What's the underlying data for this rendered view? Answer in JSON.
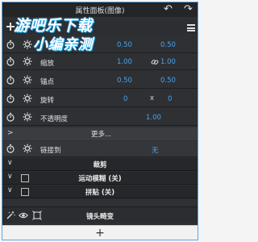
{
  "titlebar": {
    "title": "属性面板(图像)",
    "undo_glyph": "↶",
    "redo_glyph": "↷"
  },
  "watermark": {
    "line1": "游吧乐下载",
    "line2": "小编亲测"
  },
  "rows": {
    "anchor_top": {
      "v1": "0.50",
      "v2": "0.50"
    },
    "scale": {
      "label": "缩放",
      "v1": "1.00",
      "v2": "1.00"
    },
    "anchor": {
      "label": "锚点",
      "v1": "0.50",
      "v2": "0.50"
    },
    "rotation": {
      "label": "旋转",
      "v1": "0",
      "mid": "x",
      "v2": "0"
    },
    "opacity": {
      "label": "不透明度",
      "v2": "1.00"
    }
  },
  "more": {
    "label": "更多..."
  },
  "parent": {
    "label": "链接到",
    "value": "无"
  },
  "sections": {
    "crop": "裁剪",
    "motion_blur": "运动模糊 (关)",
    "tile": "拼贴 (关)"
  },
  "bottom": {
    "label": "镜头畸变"
  },
  "addbar": {
    "plus": "+"
  },
  "colors": {
    "accent": "#4aa3ef",
    "panel": "#2e3033",
    "border": "#5aa8e8"
  }
}
